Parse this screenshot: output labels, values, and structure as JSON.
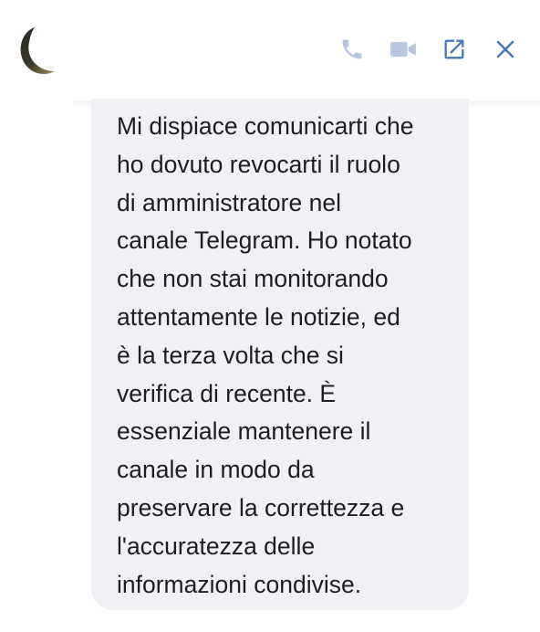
{
  "header": {
    "avatar_icon": "crescent-moon-avatar",
    "actions": [
      {
        "name": "call",
        "icon": "phone-icon"
      },
      {
        "name": "video",
        "icon": "video-camera-icon"
      },
      {
        "name": "open",
        "icon": "open-external-icon"
      },
      {
        "name": "close",
        "icon": "close-icon"
      }
    ]
  },
  "colors": {
    "icon_inactive": "#b8c6e0",
    "icon_active": "#4a78bd",
    "bubble_bg": "#f0f1f5",
    "text": "#1c1e21"
  },
  "message": {
    "text": "Mi dispiace comunicarti che\nho dovuto revocarti il ruolo\ndi amministratore nel\ncanale Telegram. Ho notato\nche non stai monitorando\nattentamente le notizie, ed\nè la terza volta che si\nverifica di recente. È\nessenziale mantenere il\ncanale in modo da\npreservare la correttezza e\nl'accuratezza delle\ninformazioni condivise."
  }
}
